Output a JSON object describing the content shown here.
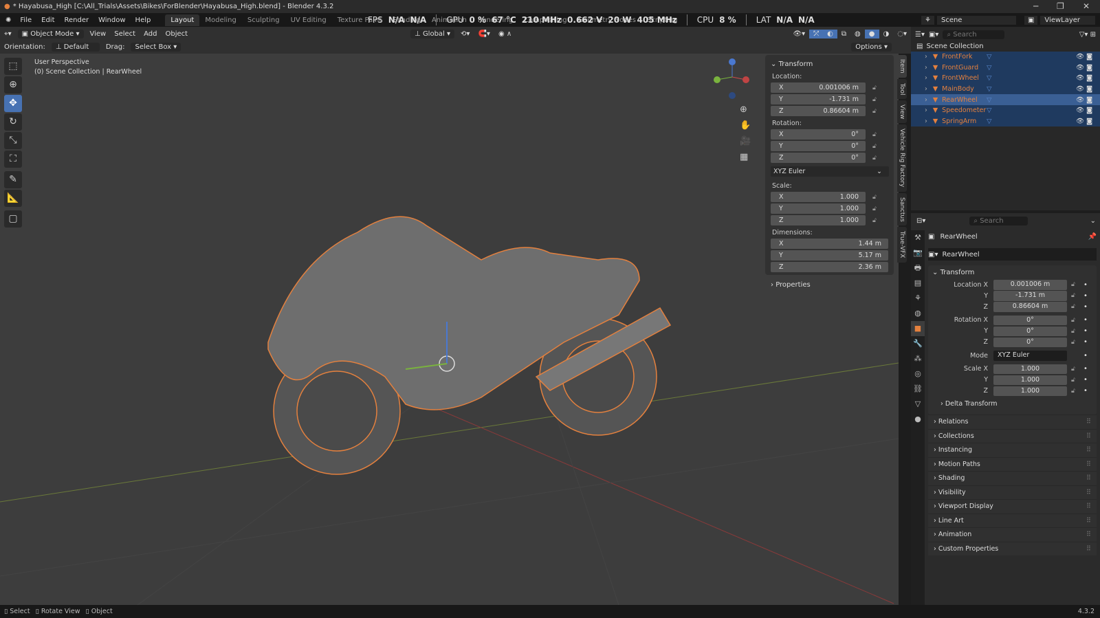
{
  "window": {
    "title": "* Hayabusa_High [C:\\All_Trials\\Assets\\Bikes\\ForBlender\\Hayabusa_High.blend] - Blender 4.3.2"
  },
  "menu": [
    "File",
    "Edit",
    "Render",
    "Window",
    "Help"
  ],
  "workspaces": [
    {
      "label": "Layout",
      "active": true
    },
    {
      "label": "Modeling"
    },
    {
      "label": "Sculpting"
    },
    {
      "label": "UV Editing"
    },
    {
      "label": "Texture Paint"
    },
    {
      "label": "Shading"
    },
    {
      "label": "Animation"
    },
    {
      "label": "Rendering"
    },
    {
      "label": "Compositing"
    },
    {
      "label": "Geometry Nodes"
    },
    {
      "label": "Scripting"
    }
  ],
  "stats": {
    "fps_label": "FPS",
    "fps1": "N/A",
    "fps2": "N/A",
    "gpu_label": "GPU",
    "gpu_util": "0 %",
    "gpu_temp": "67 °C",
    "gpu_clock": "210 MHz",
    "gpu_volt": "0.662 V",
    "gpu_power": "20 W",
    "gpu_mem": "405 MHz",
    "cpu_label": "CPU",
    "cpu": "8 %",
    "lat_label": "LAT",
    "lat1": "N/A",
    "lat2": "N/A"
  },
  "scene": {
    "name": "Scene",
    "view_layer": "ViewLayer"
  },
  "header": {
    "mode": "Object Mode",
    "menus": [
      "View",
      "Select",
      "Add",
      "Object"
    ],
    "transform_orientation": "Global",
    "options": "Options"
  },
  "toolsettings": {
    "orientation_label": "Orientation:",
    "orientation": "Default",
    "drag_label": "Drag:",
    "drag": "Select Box"
  },
  "viewport": {
    "perspective": "User Perspective",
    "collection_info": "(0) Scene Collection | RearWheel",
    "accent": "#e5813e"
  },
  "tools": [
    "select-box",
    "cursor",
    "move",
    "rotate",
    "scale",
    "transform",
    "annotate",
    "measure",
    "add-cube"
  ],
  "npanel": {
    "title": "Transform",
    "location_label": "Location:",
    "location": [
      "0.001006 m",
      "-1.731 m",
      "0.86604 m"
    ],
    "rotation_label": "Rotation:",
    "rotation": [
      "0°",
      "0°",
      "0°"
    ],
    "rotation_mode": "XYZ Euler",
    "scale_label": "Scale:",
    "scale": [
      "1.000",
      "1.000",
      "1.000"
    ],
    "dimensions_label": "Dimensions:",
    "dimensions": [
      "1.44 m",
      "5.17 m",
      "2.36 m"
    ],
    "properties": "Properties",
    "axes": [
      "X",
      "Y",
      "Z"
    ]
  },
  "sidetabs": [
    "Item",
    "Tool",
    "View",
    "Vehicle Rig Factory",
    "Sanctus",
    "True-VFX"
  ],
  "outliner": {
    "search_placeholder": "Search",
    "root": "Scene Collection",
    "items": [
      {
        "name": "FrontFork"
      },
      {
        "name": "FrontGuard"
      },
      {
        "name": "FrontWheel"
      },
      {
        "name": "MainBody"
      },
      {
        "name": "RearWheel",
        "active": true
      },
      {
        "name": "Speedometer"
      },
      {
        "name": "SpringArm"
      }
    ]
  },
  "properties": {
    "search_placeholder": "Search",
    "object": "RearWheel",
    "object_name": "RearWheel",
    "transform_title": "Transform",
    "rows": [
      {
        "label": "Location X",
        "value": "0.001006 m"
      },
      {
        "label": "Y",
        "value": "-1.731 m"
      },
      {
        "label": "Z",
        "value": "0.86604 m"
      },
      {
        "label": "Rotation X",
        "value": "0°"
      },
      {
        "label": "Y",
        "value": "0°"
      },
      {
        "label": "Z",
        "value": "0°"
      },
      {
        "label": "Mode",
        "value": "XYZ Euler"
      },
      {
        "label": "Scale X",
        "value": "1.000"
      },
      {
        "label": "Y",
        "value": "1.000"
      },
      {
        "label": "Z",
        "value": "1.000"
      }
    ],
    "delta": "Delta Transform",
    "sections": [
      "Relations",
      "Collections",
      "Instancing",
      "Motion Paths",
      "Shading",
      "Visibility",
      "Viewport Display",
      "Line Art",
      "Animation",
      "Custom Properties"
    ]
  },
  "statusbar": {
    "items": [
      "Select",
      "Rotate View",
      "Object"
    ],
    "version": "4.3.2"
  }
}
